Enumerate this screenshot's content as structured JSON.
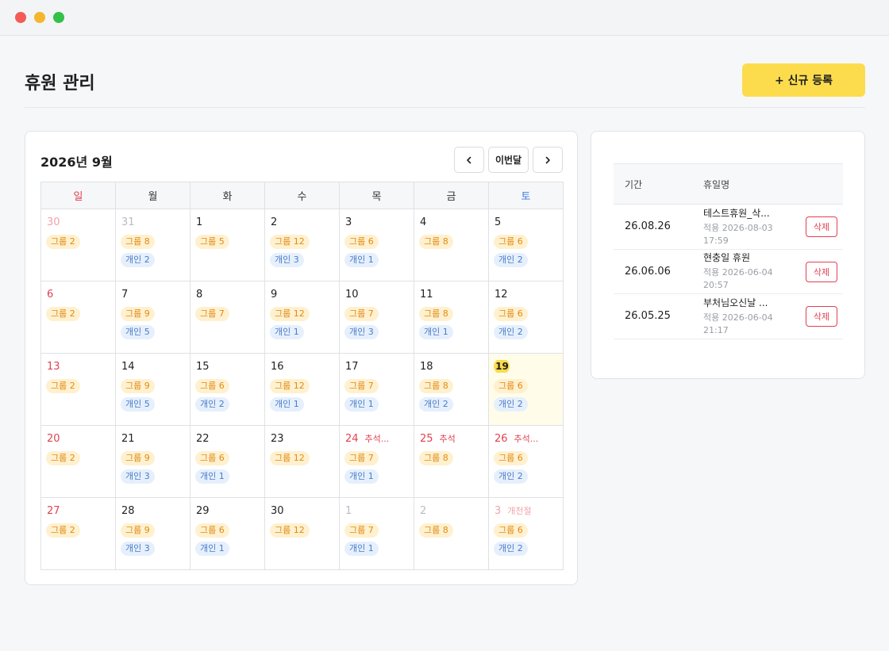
{
  "page": {
    "title": "휴원 관리",
    "new_button": "+ 신규 등록"
  },
  "calendar": {
    "title": "2026년 9월",
    "today_label": "이번달",
    "weekdays": [
      "일",
      "월",
      "화",
      "수",
      "목",
      "금",
      "토"
    ],
    "weeks": [
      [
        {
          "day": "30",
          "faded": true,
          "chips": [
            {
              "type": "group",
              "label": "그룹 2"
            }
          ]
        },
        {
          "day": "31",
          "faded": true,
          "chips": [
            {
              "type": "group",
              "label": "그룹 8"
            },
            {
              "type": "personal",
              "label": "개인 2"
            }
          ]
        },
        {
          "day": "1",
          "chips": [
            {
              "type": "group",
              "label": "그룹 5"
            }
          ]
        },
        {
          "day": "2",
          "chips": [
            {
              "type": "group",
              "label": "그룹 12"
            },
            {
              "type": "personal",
              "label": "개인 3"
            }
          ]
        },
        {
          "day": "3",
          "chips": [
            {
              "type": "group",
              "label": "그룹 6"
            },
            {
              "type": "personal",
              "label": "개인 1"
            }
          ]
        },
        {
          "day": "4",
          "chips": [
            {
              "type": "group",
              "label": "그룹 8"
            }
          ]
        },
        {
          "day": "5",
          "chips": [
            {
              "type": "group",
              "label": "그룹 6"
            },
            {
              "type": "personal",
              "label": "개인 2"
            }
          ]
        }
      ],
      [
        {
          "day": "6",
          "chips": [
            {
              "type": "group",
              "label": "그룹 2"
            }
          ]
        },
        {
          "day": "7",
          "chips": [
            {
              "type": "group",
              "label": "그룹 9"
            },
            {
              "type": "personal",
              "label": "개인 5"
            }
          ]
        },
        {
          "day": "8",
          "chips": [
            {
              "type": "group",
              "label": "그룹 7"
            }
          ]
        },
        {
          "day": "9",
          "chips": [
            {
              "type": "group",
              "label": "그룹 12"
            },
            {
              "type": "personal",
              "label": "개인 1"
            }
          ]
        },
        {
          "day": "10",
          "chips": [
            {
              "type": "group",
              "label": "그룹 7"
            },
            {
              "type": "personal",
              "label": "개인 3"
            }
          ]
        },
        {
          "day": "11",
          "chips": [
            {
              "type": "group",
              "label": "그룹 8"
            },
            {
              "type": "personal",
              "label": "개인 1"
            }
          ]
        },
        {
          "day": "12",
          "chips": [
            {
              "type": "group",
              "label": "그룹 6"
            },
            {
              "type": "personal",
              "label": "개인 2"
            }
          ]
        }
      ],
      [
        {
          "day": "13",
          "chips": [
            {
              "type": "group",
              "label": "그룹 2"
            }
          ]
        },
        {
          "day": "14",
          "chips": [
            {
              "type": "group",
              "label": "그룹 9"
            },
            {
              "type": "personal",
              "label": "개인 5"
            }
          ]
        },
        {
          "day": "15",
          "chips": [
            {
              "type": "group",
              "label": "그룹 6"
            },
            {
              "type": "personal",
              "label": "개인 2"
            }
          ]
        },
        {
          "day": "16",
          "chips": [
            {
              "type": "group",
              "label": "그룹 12"
            },
            {
              "type": "personal",
              "label": "개인 1"
            }
          ]
        },
        {
          "day": "17",
          "chips": [
            {
              "type": "group",
              "label": "그룹 7"
            },
            {
              "type": "personal",
              "label": "개인 1"
            }
          ]
        },
        {
          "day": "18",
          "chips": [
            {
              "type": "group",
              "label": "그룹 8"
            },
            {
              "type": "personal",
              "label": "개인 2"
            }
          ]
        },
        {
          "day": "19",
          "today": true,
          "chips": [
            {
              "type": "group",
              "label": "그룹 6"
            },
            {
              "type": "personal",
              "label": "개인 2"
            }
          ]
        }
      ],
      [
        {
          "day": "20",
          "chips": [
            {
              "type": "group",
              "label": "그룹 2"
            }
          ]
        },
        {
          "day": "21",
          "chips": [
            {
              "type": "group",
              "label": "그룹 9"
            },
            {
              "type": "personal",
              "label": "개인 3"
            }
          ]
        },
        {
          "day": "22",
          "chips": [
            {
              "type": "group",
              "label": "그룹 6"
            },
            {
              "type": "personal",
              "label": "개인 1"
            }
          ]
        },
        {
          "day": "23",
          "chips": [
            {
              "type": "group",
              "label": "그룹 12"
            }
          ]
        },
        {
          "day": "24",
          "holiday": "추석...",
          "chips": [
            {
              "type": "group",
              "label": "그룹 7"
            },
            {
              "type": "personal",
              "label": "개인 1"
            }
          ]
        },
        {
          "day": "25",
          "holiday": "추석",
          "chips": [
            {
              "type": "group",
              "label": "그룹 8"
            }
          ]
        },
        {
          "day": "26",
          "holiday": "추석...",
          "chips": [
            {
              "type": "group",
              "label": "그룹 6"
            },
            {
              "type": "personal",
              "label": "개인 2"
            }
          ]
        }
      ],
      [
        {
          "day": "27",
          "chips": [
            {
              "type": "group",
              "label": "그룹 2"
            }
          ]
        },
        {
          "day": "28",
          "chips": [
            {
              "type": "group",
              "label": "그룹 9"
            },
            {
              "type": "personal",
              "label": "개인 3"
            }
          ]
        },
        {
          "day": "29",
          "chips": [
            {
              "type": "group",
              "label": "그룹 6"
            },
            {
              "type": "personal",
              "label": "개인 1"
            }
          ]
        },
        {
          "day": "30",
          "chips": [
            {
              "type": "group",
              "label": "그룹 12"
            }
          ]
        },
        {
          "day": "1",
          "faded": true,
          "chips": [
            {
              "type": "group",
              "label": "그룹 7"
            },
            {
              "type": "personal",
              "label": "개인 1"
            }
          ]
        },
        {
          "day": "2",
          "faded": true,
          "chips": [
            {
              "type": "group",
              "label": "그룹 8"
            }
          ]
        },
        {
          "day": "3",
          "faded": true,
          "holiday": "개천절",
          "chips": [
            {
              "type": "group",
              "label": "그룹 6"
            },
            {
              "type": "personal",
              "label": "개인 2"
            }
          ]
        }
      ]
    ]
  },
  "holiday_list": {
    "col_period": "기간",
    "col_name": "휴일명",
    "delete_label": "삭제",
    "rows": [
      {
        "date": "26.08.26",
        "name": "테스트휴원_삭...",
        "applied": "적용 2026-08-03",
        "time": "17:59"
      },
      {
        "date": "26.06.06",
        "name": "현충일 휴원",
        "applied": "적용 2026-06-04",
        "time": "20:57"
      },
      {
        "date": "26.05.25",
        "name": "부처님오신날 ...",
        "applied": "적용 2026-06-04",
        "time": "21:17"
      }
    ]
  },
  "colors": {
    "accent": "#fcdc4d",
    "sunday": "#e14152",
    "saturday": "#3e7be0",
    "group_chip_bg": "#fff1cf",
    "group_chip_text": "#e08a15",
    "personal_chip_bg": "#e6f0fc",
    "personal_chip_text": "#4a7bc8"
  }
}
